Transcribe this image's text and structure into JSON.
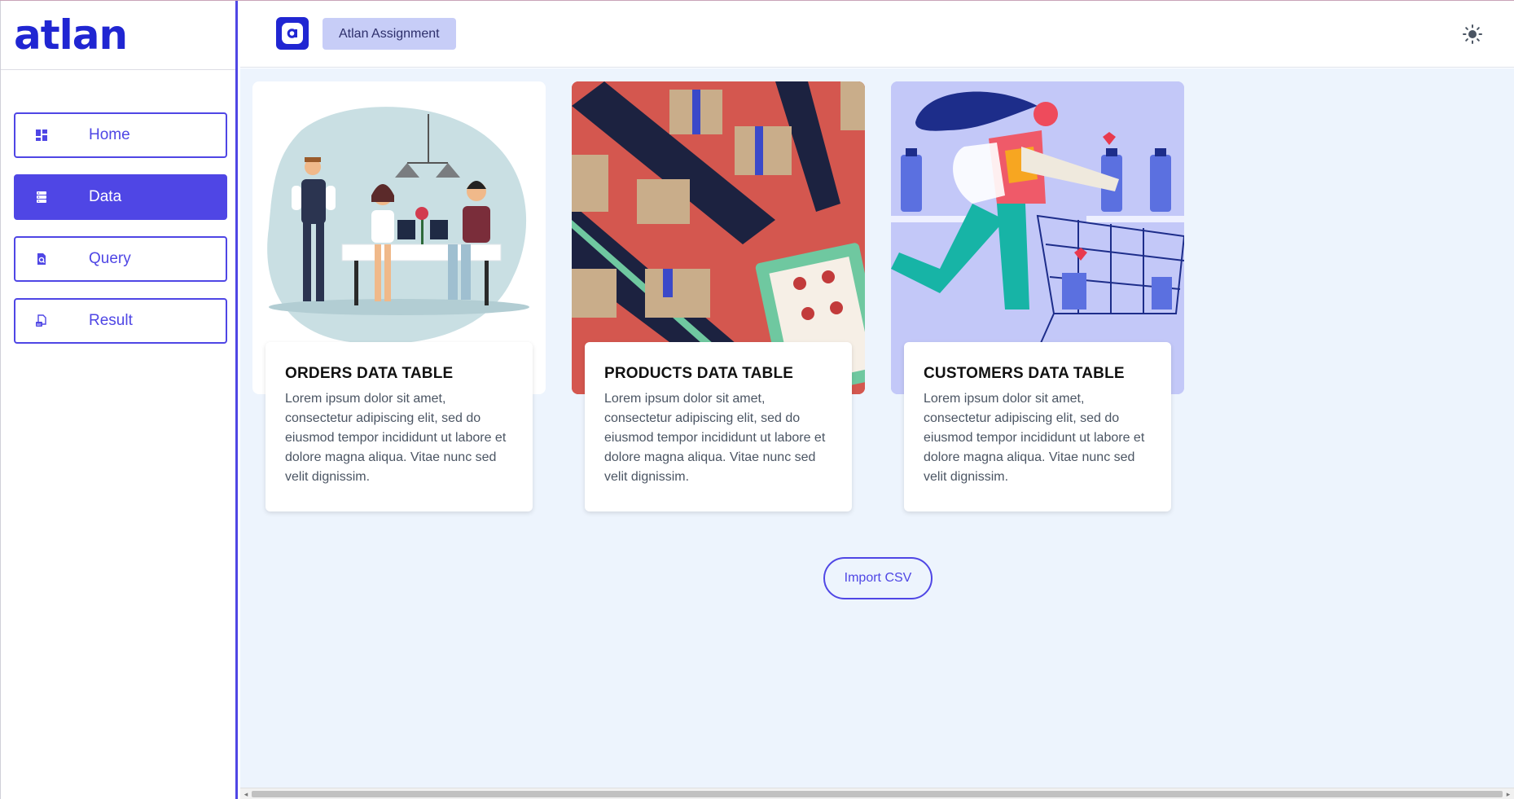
{
  "app": {
    "logo_text": "atlan",
    "header_title": "Atlan Assignment"
  },
  "sidebar": {
    "items": [
      {
        "label": "Home",
        "icon": "dashboard-icon",
        "active": false
      },
      {
        "label": "Data",
        "icon": "database-icon",
        "active": true
      },
      {
        "label": "Query",
        "icon": "search-file-icon",
        "active": false
      },
      {
        "label": "Result",
        "icon": "result-file-icon",
        "active": false
      }
    ]
  },
  "cards": [
    {
      "title": "ORDERS DATA TABLE",
      "text": "Lorem ipsum dolor sit amet, consectetur adipiscing elit, sed do eiusmod tempor incididunt ut labore et dolore magna aliqua. Vitae nunc sed velit dignissim.",
      "image": "restaurant-illustration"
    },
    {
      "title": "PRODUCTS DATA TABLE",
      "text": "Lorem ipsum dolor sit amet, consectetur adipiscing elit, sed do eiusmod tempor incididunt ut labore et dolore magna aliqua. Vitae nunc sed velit dignissim.",
      "image": "conveyor-boxes-illustration"
    },
    {
      "title": "CUSTOMERS DATA TABLE",
      "text": "Lorem ipsum dolor sit amet, consectetur adipiscing elit, sed do eiusmod tempor incididunt ut labore et dolore magna aliqua. Vitae nunc sed velit dignissim.",
      "image": "shopper-illustration"
    }
  ],
  "actions": {
    "import_label": "Import CSV"
  },
  "colors": {
    "primary": "#4f46e5",
    "brand": "#2026d2",
    "main_bg": "#edf4fd",
    "chip_bg": "#c7cdf7"
  }
}
